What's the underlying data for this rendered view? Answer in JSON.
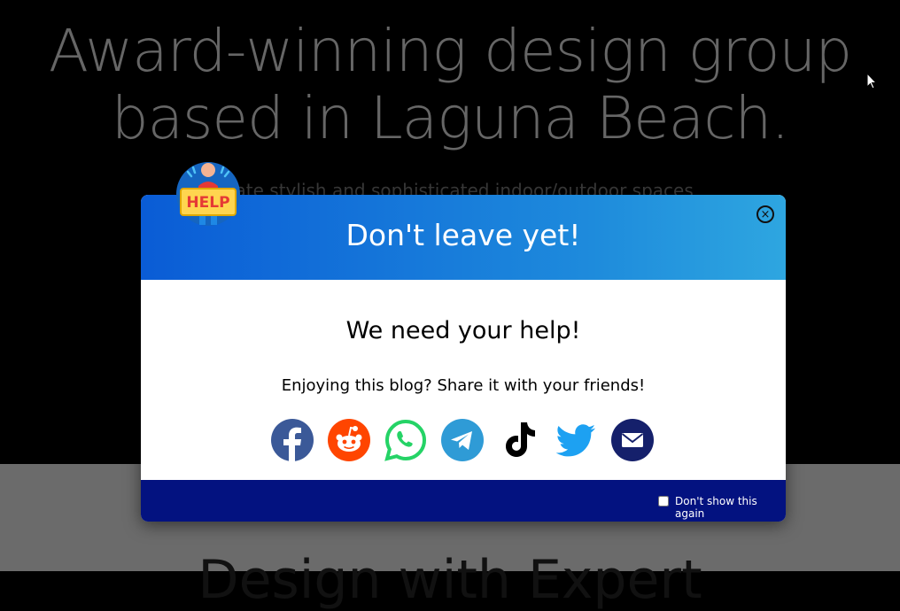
{
  "hero": {
    "title_line1": "Award-winning design group",
    "title_line2": "based in Laguna Beach.",
    "subtitle": "…eate stylish and sophisticated indoor/outdoor spaces"
  },
  "below": {
    "title": "Design with Expert"
  },
  "modal": {
    "title": "Don't leave yet!",
    "heading": "We need your help!",
    "subheading": "Enjoying this blog? Share it with your friends!",
    "close_icon": "×",
    "help_badge": "HELP",
    "share_icons": [
      "facebook-icon",
      "reddit-icon",
      "whatsapp-icon",
      "telegram-icon",
      "tiktok-icon",
      "twitter-icon",
      "email-icon"
    ],
    "checkbox_label": "Don't show this again",
    "checkbox_checked": false
  },
  "colors": {
    "header_gradient_start": "#0a5cd6",
    "header_gradient_end": "#2ea6e0",
    "footer": "#031280",
    "facebook": "#3b5998",
    "reddit": "#ff4500",
    "whatsapp": "#25d366",
    "telegram": "#2f9bd6",
    "twitter": "#1da1f2",
    "email": "#15206b"
  }
}
